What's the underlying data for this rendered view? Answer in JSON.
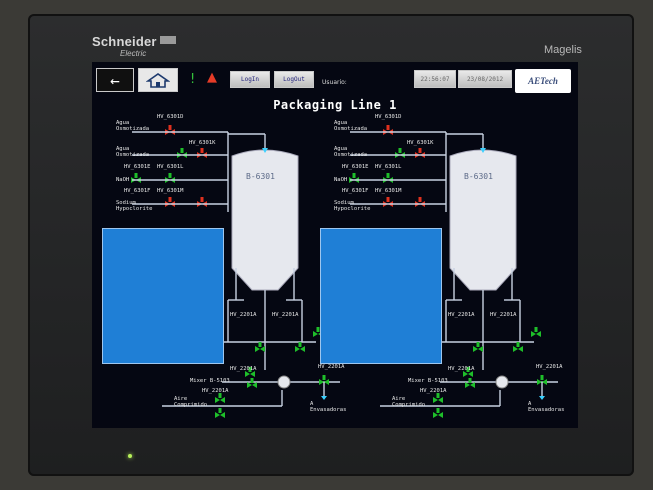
{
  "device": {
    "brand": "Schneider",
    "brand_sub": "Electric",
    "model": "Magelis"
  },
  "toolbar": {
    "back_icon": "arrow-left-icon",
    "home_icon": "home-icon",
    "alarm_icons": [
      "green-alert-icon",
      "red-warning-icon"
    ],
    "login_label": "LogIn",
    "logout_label": "LogOut",
    "user_label": "Usuario:",
    "time": "22:56:07",
    "date": "23/08/2012",
    "logo_text": "AETech"
  },
  "screen": {
    "title": "Packaging Line 1",
    "colors": {
      "background": "#050712",
      "pipe": "#c8d2e2",
      "valve_red": "#e0301e",
      "valve_green": "#1ebf2a",
      "tank": "#e6e8ee",
      "panel_blue": "#1f7fd6"
    },
    "lines": [
      {
        "tank_label": "B-6301",
        "inlets": [
          {
            "label": "Agua\nOsmotizada",
            "valve_label": "HV_6301D",
            "state": "open"
          },
          {
            "label": "Agua\nOsmotizada",
            "valve_label": "HV_6301K",
            "state": "open"
          },
          {
            "label": "NaOH",
            "valve_label": "HV_6301E",
            "state": "open"
          },
          {
            "label": "NaOH",
            "valve_label": "HV_6301L",
            "state": "open"
          },
          {
            "label": "Sodium\nHypoclorite",
            "valve_label": "HV_6301F",
            "state": "open"
          },
          {
            "label": "Sodium\nHypoclorite",
            "valve_label": "HV_6301M",
            "state": "open"
          }
        ],
        "outlet_labels": [
          "HV_2201A",
          "HV_2201A",
          "HV_2201A",
          "HV_2201A",
          "HV_2201A"
        ],
        "mixer_label": "Mixer B-5103",
        "air_label": "Aire\nComprimido",
        "dest_label": "A\nEnvasadoras"
      },
      {
        "tank_label": "B-6301",
        "inlets": [
          {
            "label": "Agua\nOsmotizada",
            "valve_label": "HV_6301D",
            "state": "open"
          },
          {
            "label": "Agua\nOsmotizada",
            "valve_label": "HV_6301K",
            "state": "open"
          },
          {
            "label": "NaOH",
            "valve_label": "HV_6301E",
            "state": "open"
          },
          {
            "label": "NaOH",
            "valve_label": "HV_6301L",
            "state": "open"
          },
          {
            "label": "Sodium\nHypoclorite",
            "valve_label": "HV_6301F",
            "state": "open"
          },
          {
            "label": "Sodium\nHypoclorite",
            "valve_label": "HV_6301M",
            "state": "open"
          }
        ],
        "outlet_labels": [
          "HV_2201A",
          "HV_2201A",
          "HV_2201A",
          "HV_2201A",
          "HV_2201A"
        ],
        "mixer_label": "Mixer B-5103",
        "air_label": "Aire\nComprimido",
        "dest_label": "A\nEnvasadoras"
      }
    ]
  }
}
